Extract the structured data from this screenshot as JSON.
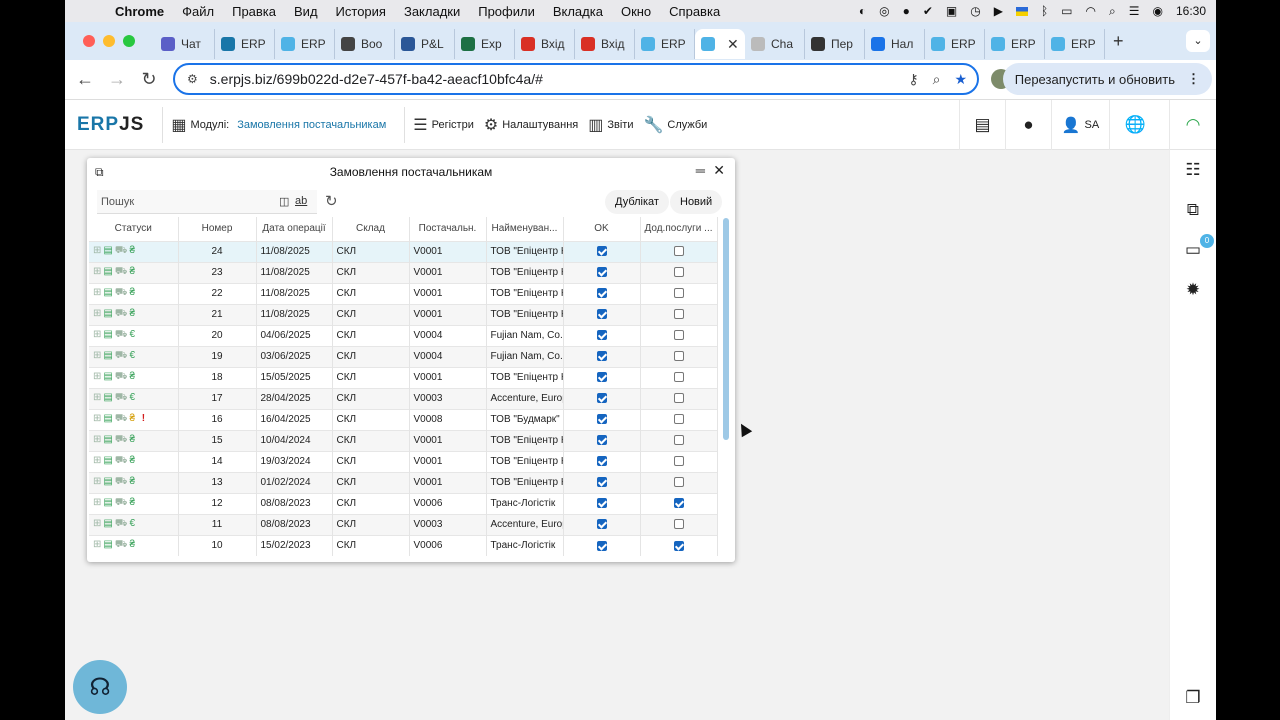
{
  "menubar": {
    "app": "Chrome",
    "items": [
      "Файл",
      "Правка",
      "Вид",
      "История",
      "Закладки",
      "Профили",
      "Вкладка",
      "Окно",
      "Справка"
    ],
    "clock": "16:30"
  },
  "tabs": [
    {
      "label": "Чат",
      "color": "#5b5fc7"
    },
    {
      "label": "ERP",
      "color": "#1976a8"
    },
    {
      "label": "ERP",
      "color": "#4fb3e6"
    },
    {
      "label": "Boo",
      "color": "#444444"
    },
    {
      "label": "P&L",
      "color": "#2b5797"
    },
    {
      "label": "Exp",
      "color": "#1d7044"
    },
    {
      "label": "Вхід",
      "color": "#d93025"
    },
    {
      "label": "Вхід",
      "color": "#d93025"
    },
    {
      "label": "ERP",
      "color": "#4fb3e6"
    },
    {
      "label": "",
      "color": "#4fb3e6",
      "active": true
    },
    {
      "label": "Cha",
      "color": "#bbbbbb"
    },
    {
      "label": "Пер",
      "color": "#333333"
    },
    {
      "label": "Нал",
      "color": "#1a73e8"
    },
    {
      "label": "ERP",
      "color": "#4fb3e6"
    },
    {
      "label": "ERP",
      "color": "#4fb3e6"
    },
    {
      "label": "ERP",
      "color": "#4fb3e6"
    }
  ],
  "address": {
    "url": "s.erpjs.biz/699b022d-d2e7-457f-ba42-aeacf10bfc4a/#",
    "restart_label": "Перезапустить и обновить"
  },
  "appbar": {
    "logo_a": "ERP",
    "logo_b": "JS",
    "modules_label": "Модулі:",
    "module_link": "Замовлення постачальникам",
    "registers": "Регістри",
    "settings": "Налаштування",
    "reports": "Звіти",
    "services": "Служби",
    "user": "SA"
  },
  "window": {
    "title": "Замовлення постачальникам",
    "search_placeholder": "Пошук",
    "duplicate_label": "Дублікат",
    "new_label": "Новий",
    "columns": [
      "Статуси",
      "Номер",
      "Дата операції",
      "Склад",
      "Постачальн.",
      "Найменуван...",
      "OK",
      "Дод.послуги ..."
    ],
    "rows": [
      {
        "status": "uah",
        "num": "24",
        "date": "11/08/2025",
        "store": "СКЛ",
        "vendor": "V0001",
        "name": "ТОВ \"Епіцентр К\"",
        "ok": true,
        "extra": false
      },
      {
        "status": "uah",
        "num": "23",
        "date": "11/08/2025",
        "store": "СКЛ",
        "vendor": "V0001",
        "name": "ТОВ \"Епіцентр К\"",
        "ok": true,
        "extra": false
      },
      {
        "status": "uah",
        "num": "22",
        "date": "11/08/2025",
        "store": "СКЛ",
        "vendor": "V0001",
        "name": "ТОВ \"Епіцентр К\"",
        "ok": true,
        "extra": false
      },
      {
        "status": "uah",
        "num": "21",
        "date": "11/08/2025",
        "store": "СКЛ",
        "vendor": "V0001",
        "name": "ТОВ \"Епіцентр К\"",
        "ok": true,
        "extra": false
      },
      {
        "status": "eur",
        "num": "20",
        "date": "04/06/2025",
        "store": "СКЛ",
        "vendor": "V0004",
        "name": "Fujian Nam, Co. Ltd",
        "ok": true,
        "extra": false
      },
      {
        "status": "eur",
        "num": "19",
        "date": "03/06/2025",
        "store": "СКЛ",
        "vendor": "V0004",
        "name": "Fujian Nam, Co. Ltd",
        "ok": true,
        "extra": false
      },
      {
        "status": "uah",
        "num": "18",
        "date": "15/05/2025",
        "store": "СКЛ",
        "vendor": "V0001",
        "name": "ТОВ \"Епіцентр К\"",
        "ok": true,
        "extra": false
      },
      {
        "status": "eur",
        "num": "17",
        "date": "28/04/2025",
        "store": "СКЛ",
        "vendor": "V0003",
        "name": "Accenture, Europe",
        "ok": true,
        "extra": false
      },
      {
        "status": "warn",
        "num": "16",
        "date": "16/04/2025",
        "store": "СКЛ",
        "vendor": "V0008",
        "name": "ТОВ \"Будмарк\"",
        "ok": true,
        "extra": false
      },
      {
        "status": "uah",
        "num": "15",
        "date": "10/04/2024",
        "store": "СКЛ",
        "vendor": "V0001",
        "name": "ТОВ \"Епіцентр К\"",
        "ok": true,
        "extra": false
      },
      {
        "status": "uah",
        "num": "14",
        "date": "19/03/2024",
        "store": "СКЛ",
        "vendor": "V0001",
        "name": "ТОВ \"Епіцентр К\"",
        "ok": true,
        "extra": false
      },
      {
        "status": "uah",
        "num": "13",
        "date": "01/02/2024",
        "store": "СКЛ",
        "vendor": "V0001",
        "name": "ТОВ \"Епіцентр К\"",
        "ok": true,
        "extra": false
      },
      {
        "status": "uah",
        "num": "12",
        "date": "08/08/2023",
        "store": "СКЛ",
        "vendor": "V0006",
        "name": "Транс-Логістік",
        "ok": true,
        "extra": true
      },
      {
        "status": "eur",
        "num": "11",
        "date": "08/08/2023",
        "store": "СКЛ",
        "vendor": "V0003",
        "name": "Accenture, Europe",
        "ok": true,
        "extra": false
      },
      {
        "status": "uah",
        "num": "10",
        "date": "15/02/2023",
        "store": "СКЛ",
        "vendor": "V0006",
        "name": "Транс-Логістік",
        "ok": true,
        "extra": true
      }
    ]
  }
}
